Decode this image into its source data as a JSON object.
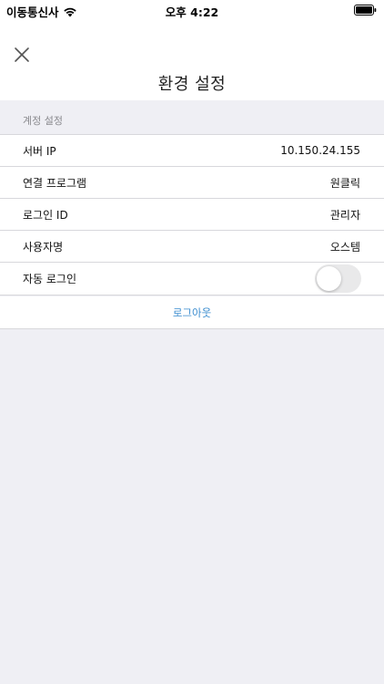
{
  "status_bar": {
    "carrier": "이동통신사",
    "time": "오후 4:22"
  },
  "header": {
    "title": "환경 설정"
  },
  "section": {
    "title": "계정 설정"
  },
  "settings": {
    "items": [
      {
        "label": "서버 IP",
        "value": "10.150.24.155"
      },
      {
        "label": "연결 프로그램",
        "value": "원클릭"
      },
      {
        "label": "로그인 ID",
        "value": "관리자"
      },
      {
        "label": "사용자명",
        "value": "오스템"
      }
    ],
    "auto_login": {
      "label": "자동 로그인",
      "enabled": false
    }
  },
  "logout": {
    "label": "로그아웃"
  },
  "colors": {
    "accent": "#3a8ccf",
    "background": "#efeff4",
    "separator": "#d8d8dc",
    "toggle_off": "#e9e9ea"
  }
}
